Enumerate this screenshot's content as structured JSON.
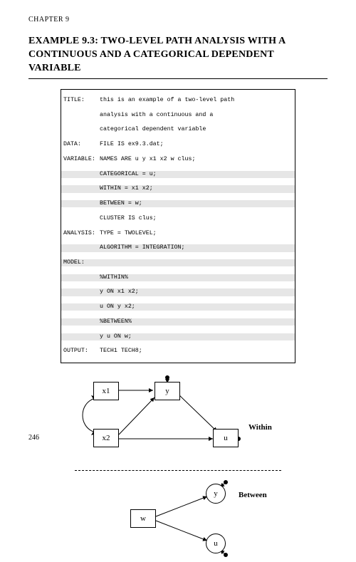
{
  "chapter": "CHAPTER 9",
  "title": "EXAMPLE 9.3: TWO-LEVEL PATH ANALYSIS WITH A CONTINUOUS AND A CATEGORICAL DEPENDENT VARIABLE",
  "code": {
    "title_kw": "TITLE:",
    "title_l1": "this is an example of a two-level path",
    "title_l2": "analysis with a continuous and a",
    "title_l3": "categorical dependent variable",
    "data_kw": "DATA:",
    "data_l1": "FILE IS ex9.3.dat;",
    "var_kw": "VARIABLE:",
    "var_l1": "NAMES ARE u y x1 x2 w clus;",
    "var_l2": "CATEGORICAL = u;",
    "var_l3": "WITHIN = x1 x2;",
    "var_l4": "BETWEEN = w;",
    "var_l5": "CLUSTER IS clus;",
    "ana_kw": "ANALYSIS:",
    "ana_l1": "TYPE = TWOLEVEL;",
    "ana_l2": "ALGORITHM = INTEGRATION;",
    "mdl_kw": "MODEL:",
    "mdl_l1": "%WITHIN%",
    "mdl_l2": "y ON x1 x2;",
    "mdl_l3": "u ON y x2;",
    "mdl_l4": "%BETWEEN%",
    "mdl_l5": "y u ON w;",
    "out_kw": "OUTPUT:",
    "out_l1": "TECH1 TECH8;"
  },
  "within": {
    "label": "Within",
    "x1": "x1",
    "x2": "x2",
    "y": "y",
    "u": "u"
  },
  "between": {
    "label": "Between",
    "w": "w",
    "y": "y",
    "u": "u"
  },
  "page": "246"
}
